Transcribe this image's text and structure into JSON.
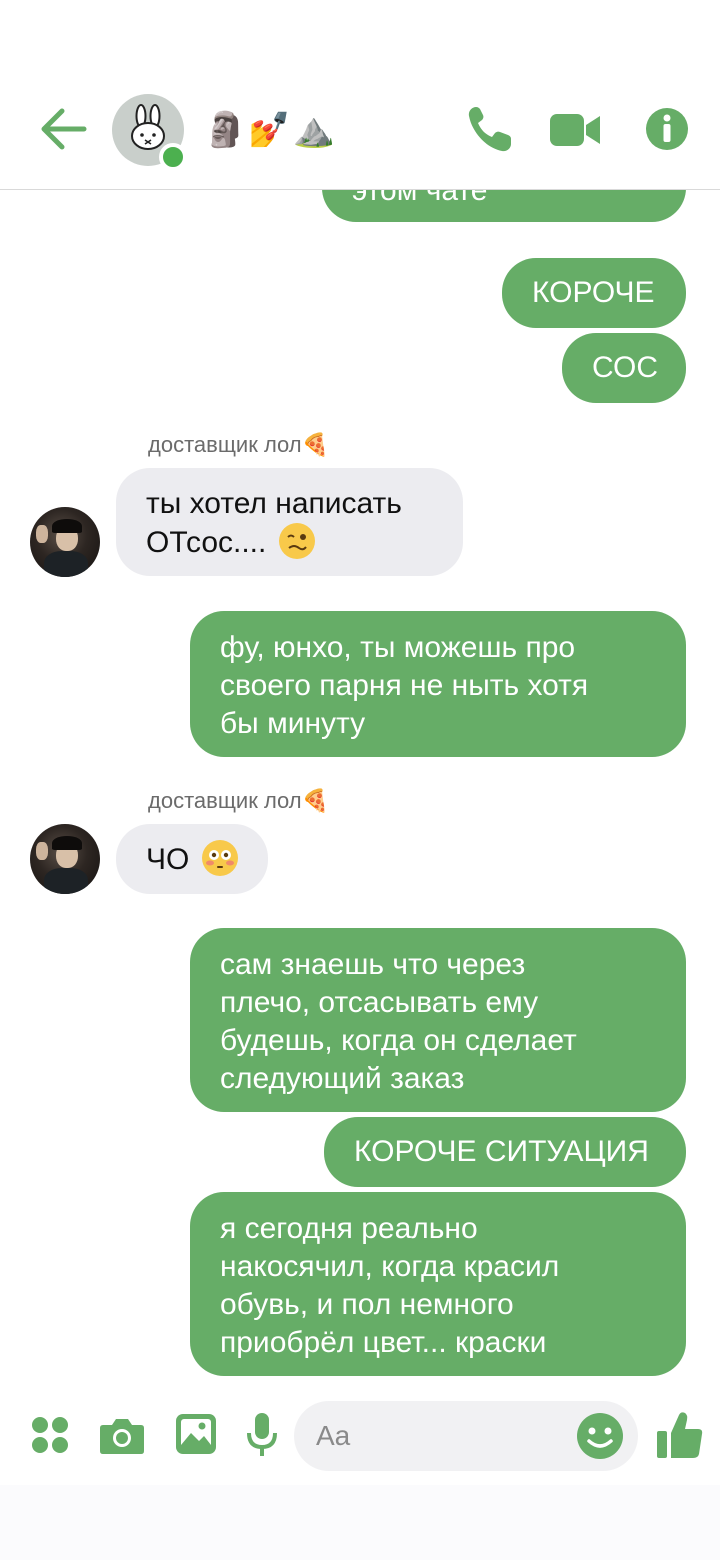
{
  "header": {
    "title": "🗿💅⛰️",
    "back_icon": "arrow-left-icon",
    "call_icon": "phone-icon",
    "video_icon": "video-camera-icon",
    "info_icon": "info-icon",
    "accent_color": "#66ad67",
    "online": true
  },
  "messages": {
    "top_partial": "этом чате",
    "m1": "КОРОЧЕ",
    "m2": "СОС",
    "sender1": "доставщик лол🍕",
    "m3_line1": "ты хотел написать",
    "m3_line2": "ОТсос....",
    "m4_line1": "фу, юнхо, ты можешь про",
    "m4_line2": "своего парня не ныть хотя",
    "m4_line3": "бы минуту",
    "sender2": "доставщик лол🍕",
    "m5": "ЧО",
    "m6_line1": "сам знаешь что через",
    "m6_line2": "плечо, отсасывать ему",
    "m6_line3": "будешь, когда он сделает",
    "m6_line4": "следующий заказ",
    "m7": "КОРОЧЕ СИТУАЦИЯ",
    "m8_line1": "я сегодня реально",
    "m8_line2": "накосячил, когда красил",
    "m8_line3": "обувь, и пол немного",
    "m8_line4": "приобрёл цвет... краски"
  },
  "composer": {
    "placeholder": "Aa",
    "icons": [
      "apps-icon",
      "camera-icon",
      "gallery-icon",
      "microphone-icon",
      "emoji-icon",
      "thumbs-up-icon"
    ]
  }
}
